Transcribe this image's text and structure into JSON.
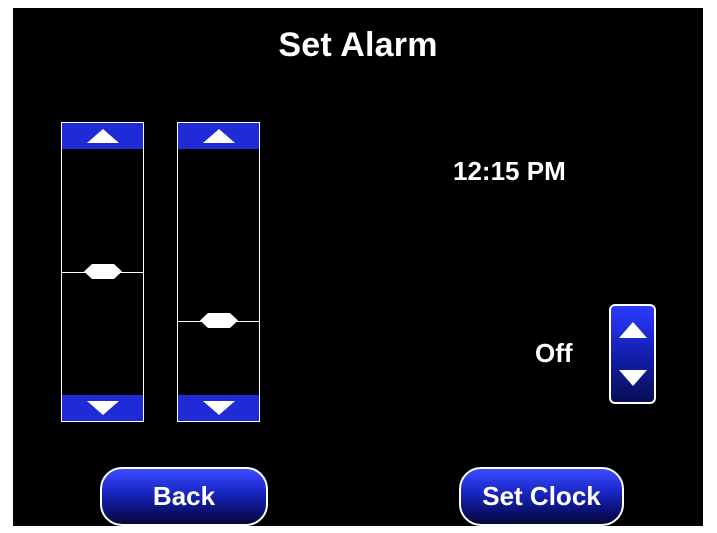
{
  "title": "Set Alarm",
  "time": "12:15 PM",
  "alarm_state": "Off",
  "sliders": [
    {
      "name": "hour",
      "level": 0.5
    },
    {
      "name": "minute",
      "level": 0.3
    }
  ],
  "buttons": {
    "back": "Back",
    "set_clock": "Set Clock"
  },
  "icons": {
    "up": "triangle-up-icon",
    "down": "triangle-down-icon",
    "knob": "diamond-knob-icon"
  },
  "colors": {
    "background": "#000000",
    "accent_blue": "#1f2bd6",
    "text": "#ffffff"
  }
}
